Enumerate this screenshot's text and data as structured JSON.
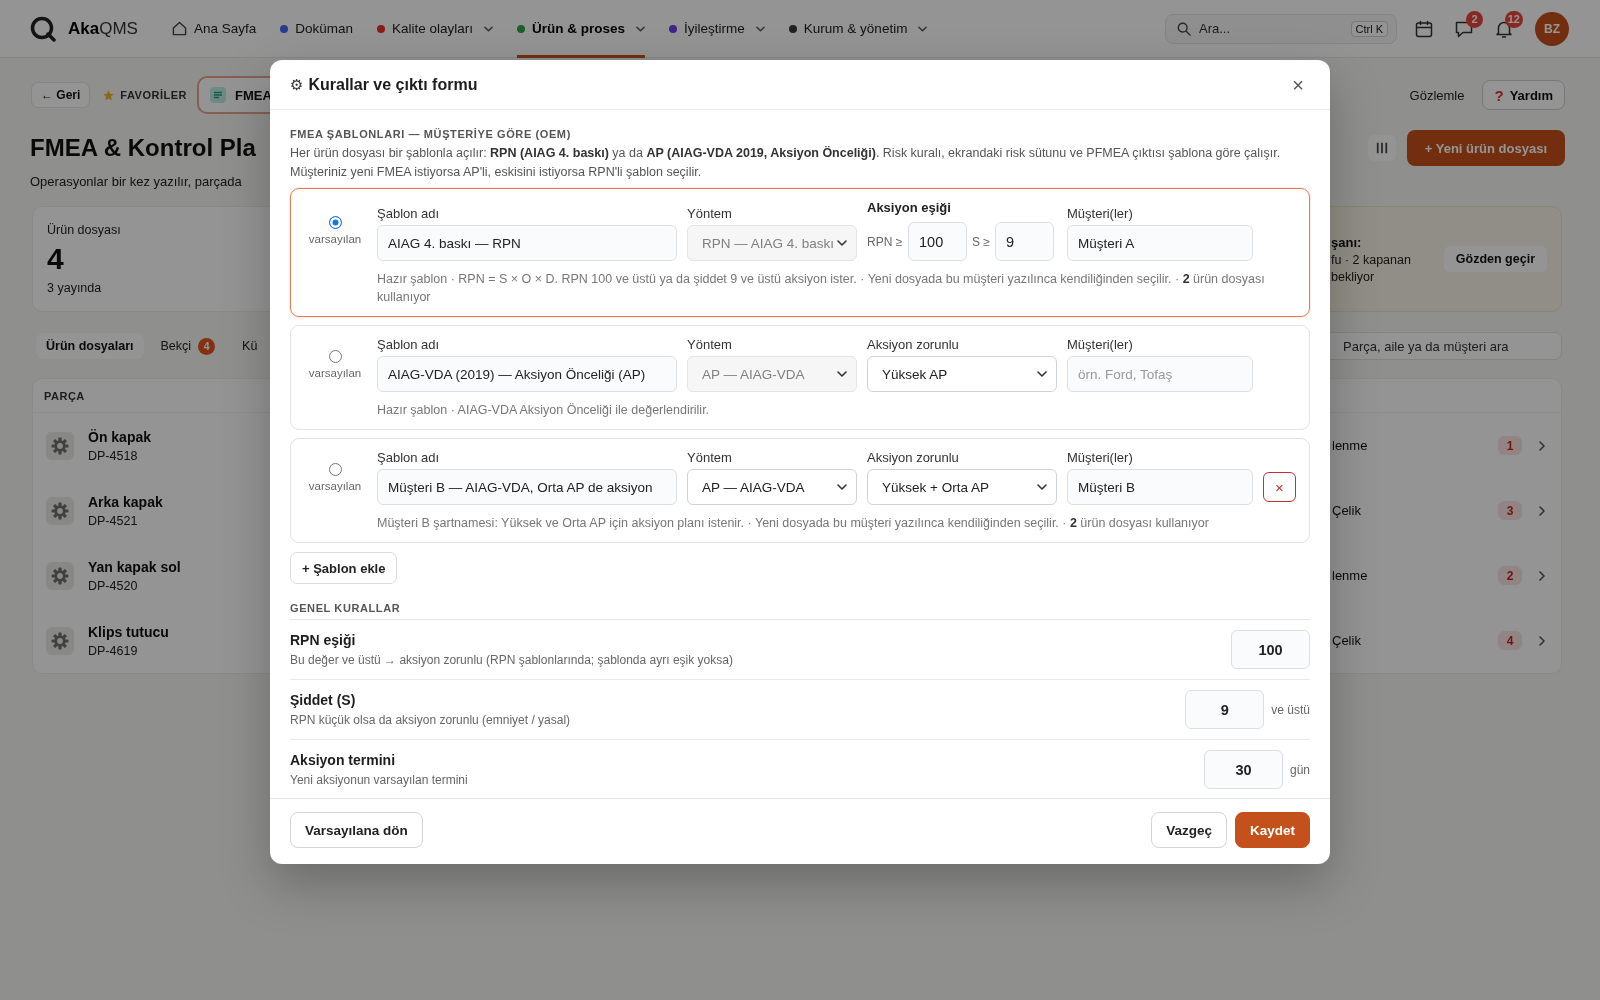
{
  "app": {
    "topbar": {
      "logo": "**Aka**QMS",
      "nav": [
        {
          "kind": "home",
          "label": "Ana Sayfa",
          "dropdown": false,
          "selected": false
        },
        {
          "kind": "section",
          "label": "Doküman",
          "color": "#283b8d",
          "dropdown": false,
          "selected": false
        },
        {
          "kind": "section",
          "label": "Kalite olayları",
          "color": "#861d1d",
          "dropdown": true,
          "selected": false
        },
        {
          "kind": "section",
          "label": "Ürün & proses",
          "color": "#1c5f29",
          "dropdown": true,
          "selected": true
        },
        {
          "kind": "section",
          "label": "İyileştirme",
          "color": "#3e2782",
          "dropdown": true,
          "selected": false
        },
        {
          "kind": "section",
          "label": "Kurum & yönetim",
          "color": "#1f2326",
          "dropdown": true,
          "selected": false
        }
      ],
      "search": {
        "placeholder": "Ara...",
        "shortcut": "Ctrl K"
      },
      "tools": [
        {
          "kind": "calendar"
        },
        {
          "kind": "chat",
          "badge": "2"
        },
        {
          "kind": "bell",
          "badge": "12"
        }
      ],
      "avatar": "BZ"
    },
    "toolbar": {
      "back": "← Geri",
      "favorites": "FAVORİLER",
      "open_tab": "FMEA",
      "watch": "Gözlemle",
      "help": {
        "icon": "?",
        "label": "Yardım"
      }
    },
    "header": {
      "title": "FMEA & Kontrol Pla",
      "subtitle": "Operasyonlar bir kez yazılır, parçada",
      "new_button": "+ Yeni ürün dosyası"
    },
    "stat": {
      "label": "Ürün dosyası",
      "value": "4",
      "note": "3 yayında"
    },
    "notice": {
      "title": "şanı:",
      "lines": [
        "fu · 2 kapanan",
        "bekliyor"
      ],
      "button": "Gözden geçir"
    },
    "tabs": [
      {
        "label": "Ürün dosyaları",
        "selected": true
      },
      {
        "label": "Bekçi",
        "badge": "4",
        "selected": false
      },
      {
        "label": "Kü",
        "selected": false
      }
    ],
    "search": {
      "placeholder": "Parça, aile ya da müşteri ara"
    },
    "table": {
      "columns": [
        "PARÇA"
      ],
      "rows": [
        {
          "part": "Ön kapak",
          "code": "DP-4518",
          "column_2": "lenme",
          "count": "1"
        },
        {
          "part": "Arka kapak",
          "code": "DP-4521",
          "column_2": "Çelik",
          "count": "3"
        },
        {
          "part": "Yan kapak sol",
          "code": "DP-4520",
          "column_2": "lenme",
          "count": "2"
        },
        {
          "part": "Klips tutucu",
          "code": "DP-4619",
          "column_2": "Çelik",
          "count": "4"
        }
      ]
    }
  },
  "dialog": {
    "icon": "⚙",
    "title": "Kurallar ve çıktı formu",
    "close": "×",
    "templates_section": {
      "heading": "FMEA ŞABLONLARI — MÜŞTERİYE GÖRE (OEM)",
      "description": "Her ürün dosyası bir şablonla açılır: **RPN (AIAG 4. baskı)** ya da **AP (AIAG-VDA 2019, Aksiyon Önceliği)**. Risk kuralı, ekrandaki risk sütunu ve PFMEA çıktısı şablona göre çalışır. Müşteriniz yeni FMEA istiyorsa AP'li, eskisini istiyorsa RPN'li şablon seçilir.",
      "templates": [
        {
          "kind": "rpn",
          "selected": true,
          "radio_label": "varsayılan",
          "name_label": "Şablon adı",
          "name": "AIAG 4. baskı — RPN",
          "method_label": "Yöntem",
          "method": {
            "value": "RPN — AIAG 4. baskı",
            "disabled": true
          },
          "threshold": {
            "label": "Aksiyon eşiği",
            "rpn_prefix": "RPN ≥",
            "rpn": "100",
            "severity_prefix": "S ≥",
            "severity": "9"
          },
          "customer_label": "Müşteri(ler)",
          "customer": {
            "value": "Müşteri A"
          },
          "note": "Hazır şablon · RPN = S × O × D. RPN 100 ve üstü ya da şiddet 9 ve üstü aksiyon ister. · Yeni dosyada bu müşteri yazılınca kendiliğinden seçilir. · **2** ürün dosyası kullanıyor"
        },
        {
          "kind": "ap",
          "selected": false,
          "radio_label": "varsayılan",
          "name_label": "Şablon adı",
          "name": "AIAG-VDA (2019) — Aksiyon Önceliği (AP)",
          "method_label": "Yöntem",
          "method": {
            "value": "AP — AIAG-VDA",
            "disabled": true
          },
          "action": {
            "label": "Aksiyon zorunlu",
            "value": "Yüksek AP"
          },
          "customer_label": "Müşteri(ler)",
          "customer": {
            "placeholder": "örn. Ford, Tofaş"
          },
          "note": "Hazır şablon · AIAG-VDA Aksiyon Önceliği ile değerlendirilir."
        },
        {
          "kind": "ap",
          "selected": false,
          "radio_label": "varsayılan",
          "name_label": "Şablon adı",
          "name": "Müşteri B — AIAG-VDA, Orta AP de aksiyon",
          "method_label": "Yöntem",
          "method": {
            "value": "AP — AIAG-VDA",
            "disabled": false
          },
          "action": {
            "label": "Aksiyon zorunlu",
            "value": "Yüksek + Orta AP"
          },
          "customer_label": "Müşteri(ler)",
          "customer": {
            "value": "Müşteri B"
          },
          "delete": "×",
          "note": "Müşteri B şartnamesi: Yüksek ve Orta AP için aksiyon planı istenir. · Yeni dosyada bu müşteri yazılınca kendiliğinden seçilir. · **2** ürün dosyası kullanıyor"
        }
      ],
      "add_button": "+ Şablon ekle"
    },
    "general_rules": {
      "heading": "GENEL KURALLAR",
      "rules": [
        {
          "title": "RPN eşiği",
          "description": "Bu değer ve üstü → aksiyon zorunlu (RPN şablonlarında; şablonda ayrı eşik yoksa)",
          "value": "100"
        },
        {
          "title": "Şiddet (S)",
          "description": "RPN küçük olsa da aksiyon zorunlu (emniyet / yasal)",
          "value": "9",
          "unit": "ve üstü"
        },
        {
          "title": "Aksiyon termini",
          "description": "Yeni aksiyonun varsayılan termini",
          "value": "30",
          "unit": "gün"
        }
      ]
    },
    "footer": {
      "reset": "Varsayılana dön",
      "cancel": "Vazgeç",
      "save": "Kaydet"
    }
  }
}
